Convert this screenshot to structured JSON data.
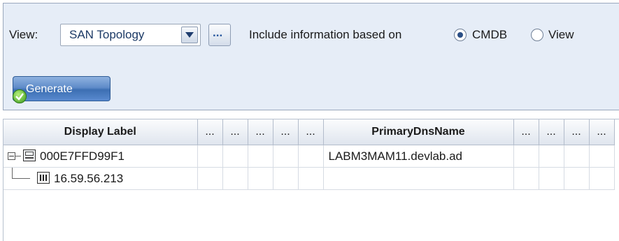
{
  "toolbar": {
    "view_label": "View:",
    "view_value": "SAN Topology",
    "dots_button": "...",
    "include_label": "Include information based on",
    "options": [
      {
        "label": "CMDB",
        "checked": true
      },
      {
        "label": "View",
        "checked": false
      }
    ],
    "generate_label": "Generate"
  },
  "grid": {
    "columns": [
      "Display Label",
      "...",
      "...",
      "...",
      "...",
      "...",
      "PrimaryDnsName",
      "...",
      "...",
      "...",
      "..."
    ],
    "rows": [
      {
        "label": "000E7FFD99F1",
        "dns": "LABM3MAM11.devlab.ad",
        "icon": "host-icon",
        "expanded": true
      },
      {
        "label": "16.59.56.213",
        "dns": "",
        "icon": "ip-address-icon",
        "child": true
      }
    ]
  }
}
